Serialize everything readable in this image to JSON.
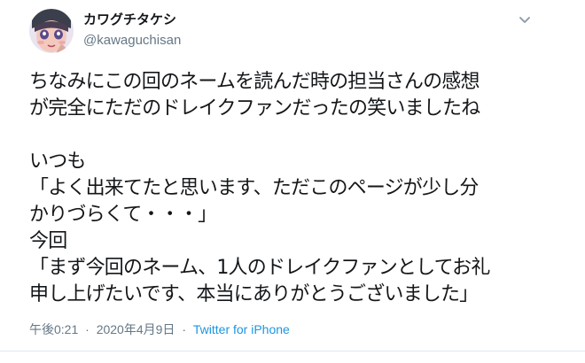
{
  "user": {
    "display_name": "カワグチタケシ",
    "handle": "@kawaguchisan"
  },
  "tweet": {
    "lines": [
      "ちなみにこの回のネームを読んだ時の担当さんの感想",
      "が完全にただのドレイクファンだったの笑いましたね",
      "",
      "いつも",
      "「よく出来てたと思います、ただこのページが少し分",
      "かりづらくて・・・」",
      "今回",
      "「まず今回のネーム、1人のドレイクファンとしてお礼",
      "申し上げたいです、本当にありがとうございました」"
    ]
  },
  "meta": {
    "time": "午後0:21",
    "separator": "·",
    "date": "2020年4月9日",
    "source": "Twitter for iPhone"
  },
  "icons": {
    "caret": "chevron-down-icon"
  },
  "colors": {
    "text": "#14171a",
    "secondary": "#657786",
    "link": "#1b95e0"
  }
}
